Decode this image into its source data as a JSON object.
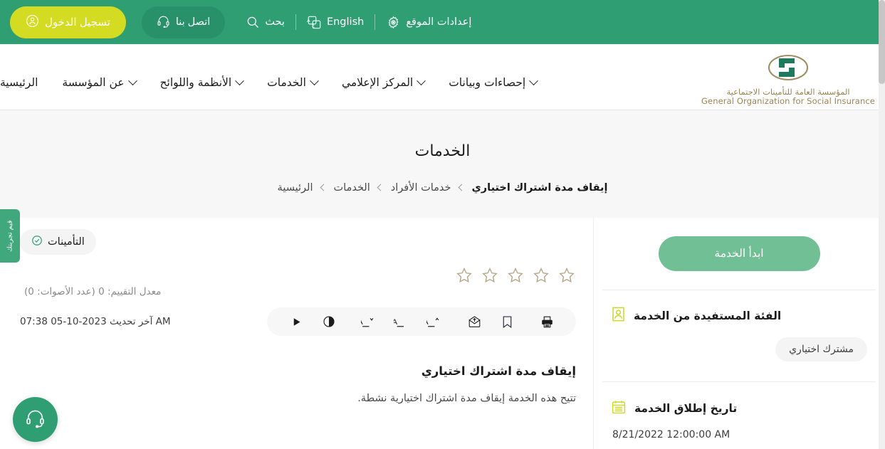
{
  "topbar": {
    "search": {
      "label": "بحث",
      "icon": "search-icon"
    },
    "language": {
      "label": "English",
      "icon": "translate-icon"
    },
    "site_settings": {
      "label": "إعدادات الموقع",
      "icon": "gear-icon"
    },
    "contact": {
      "label": "اتصل بنا",
      "icon": "headset-icon"
    },
    "login": {
      "label": "تسجيل الدخول",
      "icon": "user-circle-icon"
    },
    "bg_color": "#2f9e73",
    "login_color": "#d3dc23",
    "contact_color": "#28916a"
  },
  "brand": {
    "name_ar": "المؤسسة العامة للتأمينات الاجتماعية",
    "name_en": "General Organization for Social Insurance",
    "logo_color": "#1f7a5c",
    "accent_color": "#9a8455"
  },
  "nav": {
    "items": [
      {
        "label": "الرئيسية",
        "has_dropdown": false
      },
      {
        "label": "عن المؤسسة",
        "has_dropdown": true
      },
      {
        "label": "الأنظمة واللوائح",
        "has_dropdown": true
      },
      {
        "label": "الخدمات",
        "has_dropdown": true
      },
      {
        "label": "المركز الإعلامي",
        "has_dropdown": true
      },
      {
        "label": "إحصاءات وبيانات",
        "has_dropdown": true
      }
    ]
  },
  "page": {
    "title": "الخدمات",
    "breadcrumb": [
      {
        "label": "الرئيسية",
        "current": false
      },
      {
        "label": "الخدمات",
        "current": false
      },
      {
        "label": "خدمات الأفراد",
        "current": false
      },
      {
        "label": "إيقاف مدة اشتراك اختياري",
        "current": true
      }
    ]
  },
  "main": {
    "tag": {
      "label": "التأمينات",
      "icon": "check-circle-icon"
    },
    "rating": {
      "stars_total": 5,
      "stars_filled": 0,
      "summary": "معدل التقييم: 0 (عدد الأصوات: 0)",
      "average": 0,
      "votes": 0
    },
    "last_updated": "آخر تحديث 2023-10-05 07:38 AM",
    "toolbar": [
      {
        "name": "play-icon",
        "label": "استماع"
      },
      {
        "name": "contrast-icon",
        "label": "تباين"
      },
      {
        "name": "font-decrease-icon",
        "label": "تصغير الخط"
      },
      {
        "name": "font-reset-icon",
        "label": "حجم الخط الافتراضي"
      },
      {
        "name": "font-increase-icon",
        "label": "تكبير الخط"
      },
      {
        "name": "share-email-icon",
        "label": "مشاركة"
      },
      {
        "name": "bookmark-icon",
        "label": "إضافة إلى المفضلة"
      },
      {
        "name": "print-icon",
        "label": "طباعة"
      }
    ],
    "service_title": "إيقاف مدة اشتراك اختياري",
    "service_desc": "تتيح هذه الخدمة إيقاف مدة اشتراك اختيارية نشطة."
  },
  "side": {
    "start_button": "ابدأ الخدمة",
    "beneficiary": {
      "icon": "beneficiary-icon",
      "title": "الفئة المستفيدة من الخدمة",
      "chip": "مشترك اختياري"
    },
    "launch_date": {
      "icon": "calendar-icon",
      "title": "تاريخ إطلاق الخدمة",
      "value": "8/21/2022 12:00:00 AM"
    }
  },
  "feedback_tab": {
    "label": "قيم تجربتك"
  },
  "support_fab": {
    "label": "الدعم الفني",
    "icon": "headset-icon"
  }
}
